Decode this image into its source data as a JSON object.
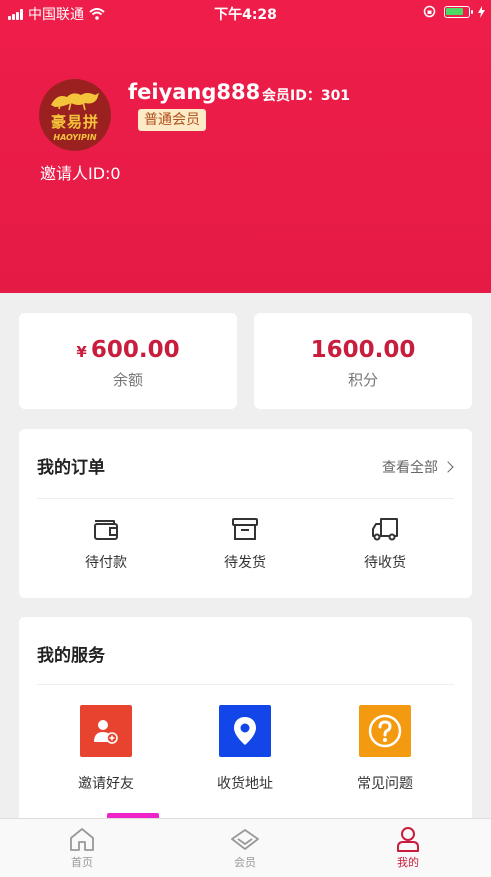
{
  "status_bar": {
    "carrier": "中国联通",
    "time": "下午4:28"
  },
  "profile": {
    "brand_cn": "豪易拼",
    "brand_en": "HAOYIPIN",
    "username": "feiyang888",
    "member_id": "会员ID：301",
    "member_level": "普通会员",
    "inviter": "邀请人ID:0"
  },
  "wallet": {
    "balance_currency": "¥",
    "balance_value": "600.00",
    "balance_label": "余额",
    "points_value": "1600.00",
    "points_label": "积分"
  },
  "orders": {
    "title": "我的订单",
    "view_all": "查看全部",
    "items": [
      {
        "label": "待付款",
        "icon": "wallet-icon"
      },
      {
        "label": "待发货",
        "icon": "box-icon"
      },
      {
        "label": "待收货",
        "icon": "truck-icon"
      }
    ]
  },
  "services": {
    "title": "我的服务",
    "items": [
      {
        "label": "邀请好友",
        "icon": "invite-friend-icon",
        "color": "#e8432e"
      },
      {
        "label": "收货地址",
        "icon": "location-pin-icon",
        "color": "#1246e8"
      },
      {
        "label": "常见问题",
        "icon": "question-icon",
        "color": "#f49a10"
      }
    ]
  },
  "tabbar": {
    "items": [
      {
        "label": "首页",
        "icon": "home-icon",
        "active": false
      },
      {
        "label": "会员",
        "icon": "diamond-icon",
        "active": false
      },
      {
        "label": "我的",
        "icon": "user-icon",
        "active": true
      }
    ]
  },
  "colors": {
    "brand_red": "#e81b47",
    "accent_price": "#c81d3d"
  }
}
